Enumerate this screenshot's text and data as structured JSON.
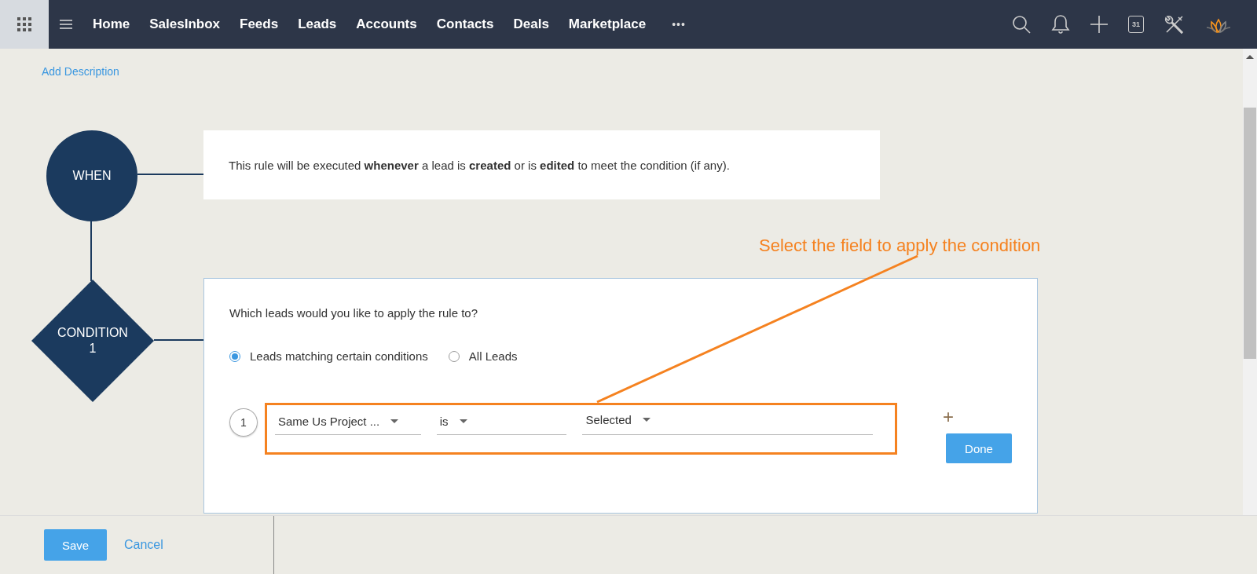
{
  "nav": {
    "items": [
      {
        "label": "Home"
      },
      {
        "label": "SalesInbox"
      },
      {
        "label": "Feeds"
      },
      {
        "label": "Leads"
      },
      {
        "label": "Accounts"
      },
      {
        "label": "Contacts"
      },
      {
        "label": "Deals"
      },
      {
        "label": "Marketplace"
      }
    ],
    "more": "•••",
    "calendar_day": "31"
  },
  "add_description": "Add Description",
  "when": {
    "label": "WHEN",
    "text": "This rule will be executed **whenever** a lead is **created** or is **edited** to meet the condition (if any)."
  },
  "condition": {
    "label": "CONDITION",
    "number": "1",
    "question": "Which leads would you like to apply the rule to?",
    "options": [
      {
        "label": "Leads matching certain conditions",
        "selected": true
      },
      {
        "label": "All Leads",
        "selected": false
      }
    ],
    "criteria": [
      {
        "index": "1",
        "field": "Same Us Project ...",
        "operator": "is",
        "value": "Selected"
      }
    ],
    "add": "+",
    "done": "Done"
  },
  "annotation": {
    "text": "Select the field to apply the condition"
  },
  "footer": {
    "save": "Save",
    "cancel": "Cancel"
  }
}
